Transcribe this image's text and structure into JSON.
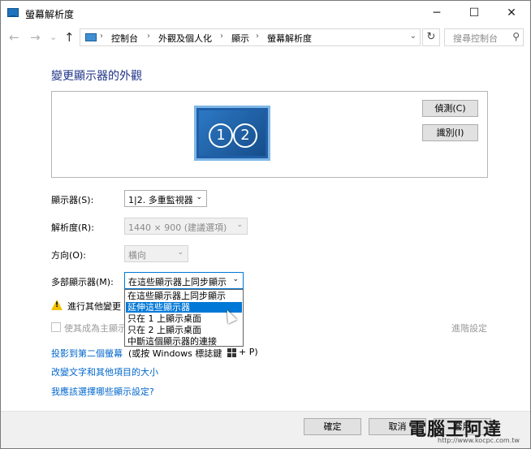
{
  "window": {
    "title": "螢幕解析度",
    "min": "─",
    "max": "☐",
    "close": "✕"
  },
  "nav": {
    "back": "←",
    "forward": "→",
    "recent": "⌄",
    "up": "↑"
  },
  "address": {
    "crumbs": [
      "控制台",
      "外觀及個人化",
      "顯示",
      "螢幕解析度"
    ],
    "separator": "›",
    "dropdown": "⌄",
    "refresh": "↻",
    "search_placeholder": "搜尋控制台",
    "search_icon": "⚲"
  },
  "heading": "變更顯示器的外觀",
  "preview": {
    "monitor_a": "1",
    "monitor_b": "2",
    "detect": "偵測(C)",
    "identify": "識別(I)"
  },
  "fields": {
    "display": {
      "label": "顯示器(S):",
      "value": "1|2. 多重監視器",
      "arrow": "⌄"
    },
    "resolution": {
      "label": "解析度(R):",
      "value": "1440 × 900 (建議選項)",
      "arrow": "⌄"
    },
    "orientation": {
      "label": "方向(O):",
      "value": "橫向",
      "arrow": "⌄"
    },
    "multiple": {
      "label": "多部顯示器(M):",
      "value": "在這些顯示器上同步顯示",
      "arrow": "⌄"
    }
  },
  "dropdown_options": [
    "在這些顯示器上同步顯示",
    "延伸這些顯示器",
    "只在 1 上顯示桌面",
    "只在 2 上顯示桌面",
    "中斷這個顯示器的連接"
  ],
  "warning_text": "進行其他變更",
  "main_display_checkbox": "使其成為主顯示",
  "advanced_link": "進階設定",
  "links": [
    "投影到第二個螢幕",
    "改變文字和其他項目的大小",
    "我應該選擇哪些顯示設定?"
  ],
  "project_suffix": "(或按 Windows 標誌鍵",
  "project_key": "+ P)",
  "buttons": {
    "ok": "確定",
    "cancel": "取消",
    "apply": "套用"
  },
  "watermark": {
    "text": "電腦王阿達",
    "url": "http://www.kocpc.com.tw"
  },
  "colors": {
    "accent": "#0078d7",
    "heading": "#1e3287",
    "link": "#0066cc"
  }
}
